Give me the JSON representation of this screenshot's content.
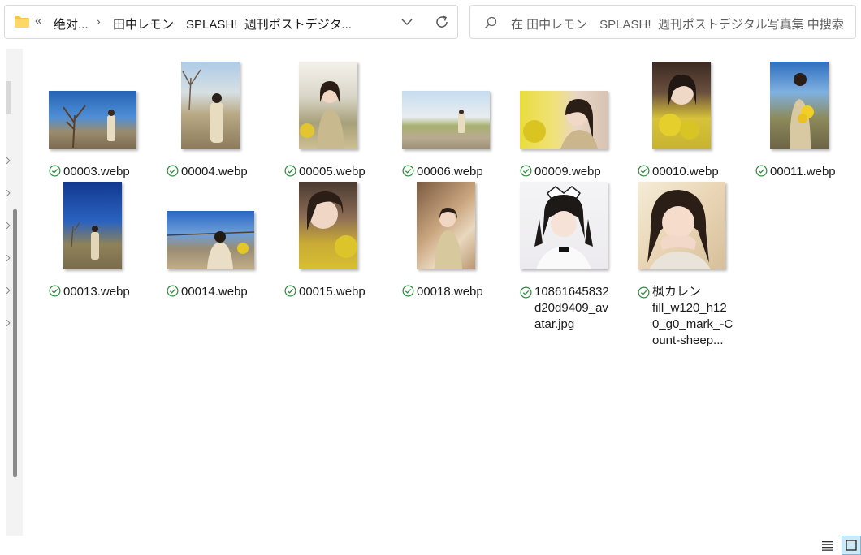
{
  "address": {
    "overflow": "«",
    "crumb1": "绝对...",
    "separator": "›",
    "crumb2": "田中レモン　SPLASH!  週刊ポストデジタ..."
  },
  "search": {
    "placeholder": "在 田中レモン　SPLASH!  週刊ポストデジタル写真集 中搜索"
  },
  "files": [
    {
      "name": "00003.webp"
    },
    {
      "name": "00004.webp"
    },
    {
      "name": "00005.webp"
    },
    {
      "name": "00006.webp"
    },
    {
      "name": "00009.webp"
    },
    {
      "name": "00010.webp"
    },
    {
      "name": "00011.webp"
    },
    {
      "name": "00013.webp"
    },
    {
      "name": "00014.webp"
    },
    {
      "name": "00015.webp"
    },
    {
      "name": "00018.webp"
    },
    {
      "name": "10861645832\nd20d9409_av\natar.jpg"
    },
    {
      "name": "枫カレン\nfill_w120_h12\n0_g0_mark_-C\nount-sheep..."
    }
  ],
  "colors": {
    "accent": "#0067c0",
    "sync_ok": "#2e8b3e",
    "folder": "#f6c344"
  },
  "icons": {
    "folder": "folder-icon",
    "dropdown": "chevron-down-icon",
    "refresh": "refresh-icon",
    "search": "search-icon",
    "status": "check-circle-icon",
    "details_view": "details-view-icon",
    "thumbnail_view": "large-icons-view-icon"
  }
}
